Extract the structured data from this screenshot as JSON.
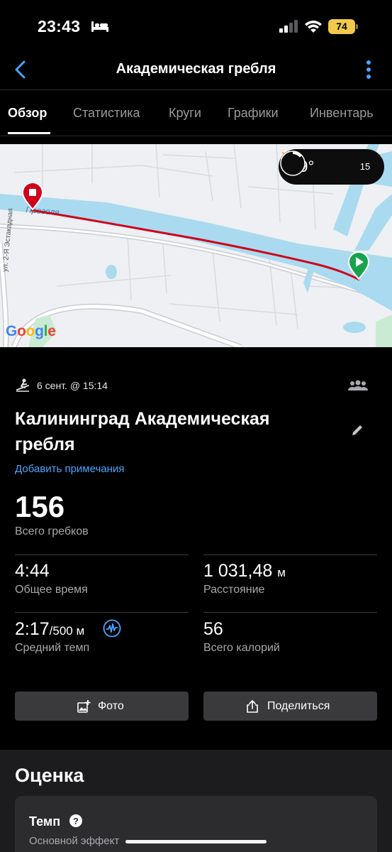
{
  "status_bar": {
    "time": "23:43",
    "battery": "74"
  },
  "nav": {
    "title": "Академическая гребля"
  },
  "tabs": [
    {
      "label": "Обзор",
      "active": true
    },
    {
      "label": "Статистика",
      "active": false
    },
    {
      "label": "Круги",
      "active": false
    },
    {
      "label": "Графики",
      "active": false
    },
    {
      "label": "Инвентарь",
      "active": false
    }
  ],
  "map": {
    "weather_temp": "19°",
    "weather_badge": "15",
    "street_label": "ул. 2-Я Эстакадная",
    "river_label": "Преголя",
    "attribution": "Google",
    "route_color": "#d0021b"
  },
  "summary": {
    "date": "6 сент. @ 15:14",
    "title": "Калининград Академическая гребля",
    "add_note": "Добавить примечания",
    "strokes_value": "156",
    "strokes_label": "Всего гребков"
  },
  "stats": {
    "time_value": "4:44",
    "time_label": "Общее время",
    "distance_value": "1 031,48",
    "distance_unit": "м",
    "distance_label": "Расстояние",
    "pace_value": "2:17",
    "pace_unit": "/500 м",
    "pace_label": "Средний темп",
    "calories_value": "56",
    "calories_label": "Всего калорий"
  },
  "actions": {
    "photo": "Фото",
    "share": "Поделиться"
  },
  "rating": {
    "title": "Оценка",
    "card_title": "Темп",
    "card_subtitle": "Основной эффект"
  }
}
